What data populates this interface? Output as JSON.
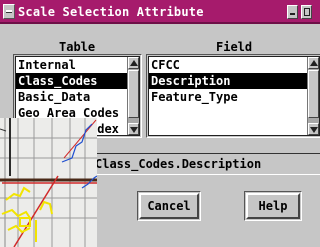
{
  "window": {
    "title": "Scale Selection Attribute",
    "title_bar_color": "#a61b6c"
  },
  "table": {
    "label": "Table",
    "items": [
      "Internal",
      "Class_Codes",
      "Basic_Data",
      "Geo_Area_Codes",
      "Index"
    ],
    "selected": "Class_Codes",
    "partial_visible_text": "ndex"
  },
  "field": {
    "label": "Field",
    "items": [
      "CFCC",
      "Description",
      "Feature_Type"
    ],
    "selected": "Description"
  },
  "selection_field": {
    "value": "Class_Codes.Description"
  },
  "buttons": {
    "cancel": "Cancel",
    "help": "Help"
  },
  "overlay": {
    "description_colors": [
      "#f2e400",
      "#d12a2a",
      "#1f4fd0",
      "#4a2a18"
    ]
  }
}
